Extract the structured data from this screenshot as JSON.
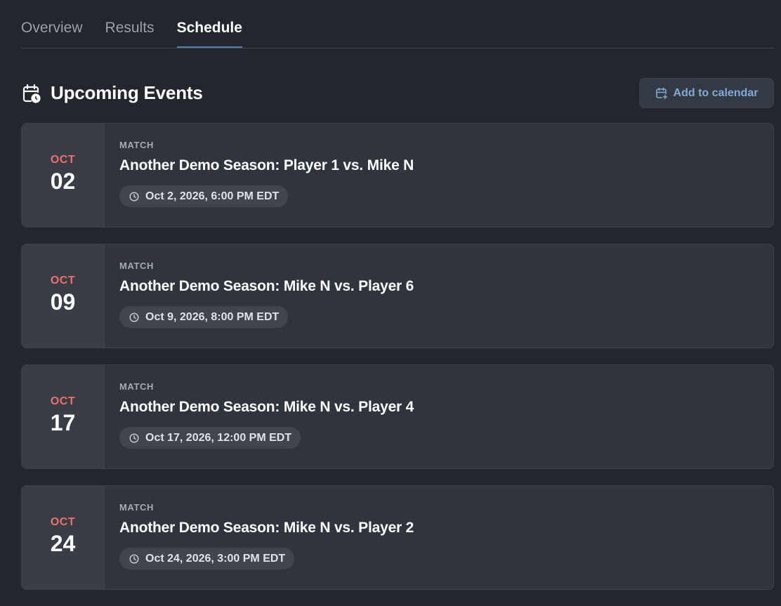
{
  "tabs": [
    {
      "label": "Overview",
      "active": false
    },
    {
      "label": "Results",
      "active": false
    },
    {
      "label": "Schedule",
      "active": true
    }
  ],
  "section": {
    "icon": "calendar-clock-icon",
    "title": "Upcoming Events",
    "add_calendar_label": "Add to calendar",
    "add_calendar_icon": "calendar-plus-icon"
  },
  "events": [
    {
      "month": "OCT",
      "day": "02",
      "type": "MATCH",
      "title": "Another Demo Season: Player 1 vs. Mike N",
      "time": "Oct 2, 2026, 6:00 PM EDT"
    },
    {
      "month": "OCT",
      "day": "09",
      "type": "MATCH",
      "title": "Another Demo Season: Mike N vs. Player 6",
      "time": "Oct 9, 2026, 8:00 PM EDT"
    },
    {
      "month": "OCT",
      "day": "17",
      "type": "MATCH",
      "title": "Another Demo Season: Mike N vs. Player 4",
      "time": "Oct 17, 2026, 12:00 PM EDT"
    },
    {
      "month": "OCT",
      "day": "24",
      "type": "MATCH",
      "title": "Another Demo Season: Mike N vs. Player 2",
      "time": "Oct 24, 2026, 3:00 PM EDT"
    }
  ],
  "colors": {
    "background": "#23272d",
    "card": "#30353d",
    "accent_blue": "#7fa9d6",
    "month_red": "#f06e6e"
  }
}
